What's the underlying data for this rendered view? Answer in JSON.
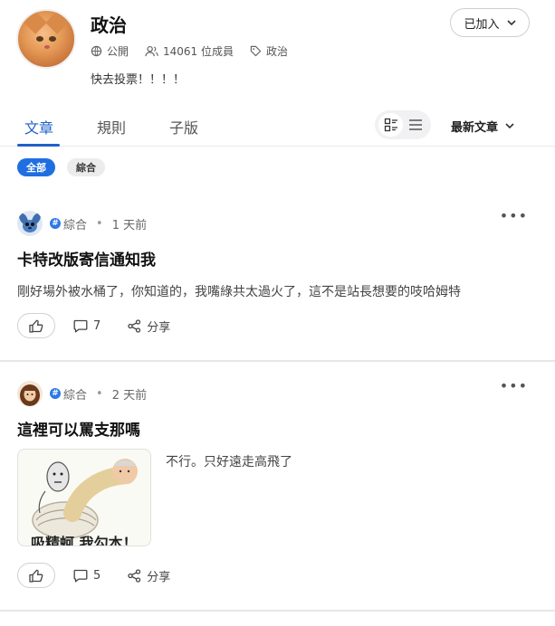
{
  "group": {
    "name": "政治",
    "visibility": "公開",
    "members": "14061 位成員",
    "tag": "政治",
    "tagline": "快去投票！！！！",
    "join_status": "已加入"
  },
  "tabs": [
    {
      "label": "文章"
    },
    {
      "label": "規則"
    },
    {
      "label": "子版"
    }
  ],
  "sort": {
    "label": "最新文章"
  },
  "filters": [
    {
      "label": "全部"
    },
    {
      "label": "綜合"
    }
  ],
  "posts": [
    {
      "board": "綜合",
      "time": "1 天前",
      "title": "卡特改版寄信通知我",
      "excerpt": "剛好場外被水桶了，你知道的，我嘴綠共太過火了，這不是站長想要的吱哈姆特",
      "comments": "7",
      "share": "分享",
      "more": "•••"
    },
    {
      "board": "綜合",
      "time": "2 天前",
      "title": "這裡可以罵支那嗎",
      "excerpt": "不行。只好遠走高飛了",
      "thumb_caption": "吸精蚵 我勾本！",
      "comments": "5",
      "share": "分享",
      "more": "•••"
    }
  ],
  "colors": {
    "accent": "#2060c8",
    "chip_active": "#1f6fe0",
    "board_badge": "#2d78e6"
  },
  "icons": [
    "lock-globe-icon",
    "members-icon",
    "tag-icon",
    "chevron-down-icon",
    "grid-view-icon",
    "list-view-icon",
    "thumbs-up-icon",
    "comment-icon",
    "share-icon",
    "more-icon"
  ]
}
